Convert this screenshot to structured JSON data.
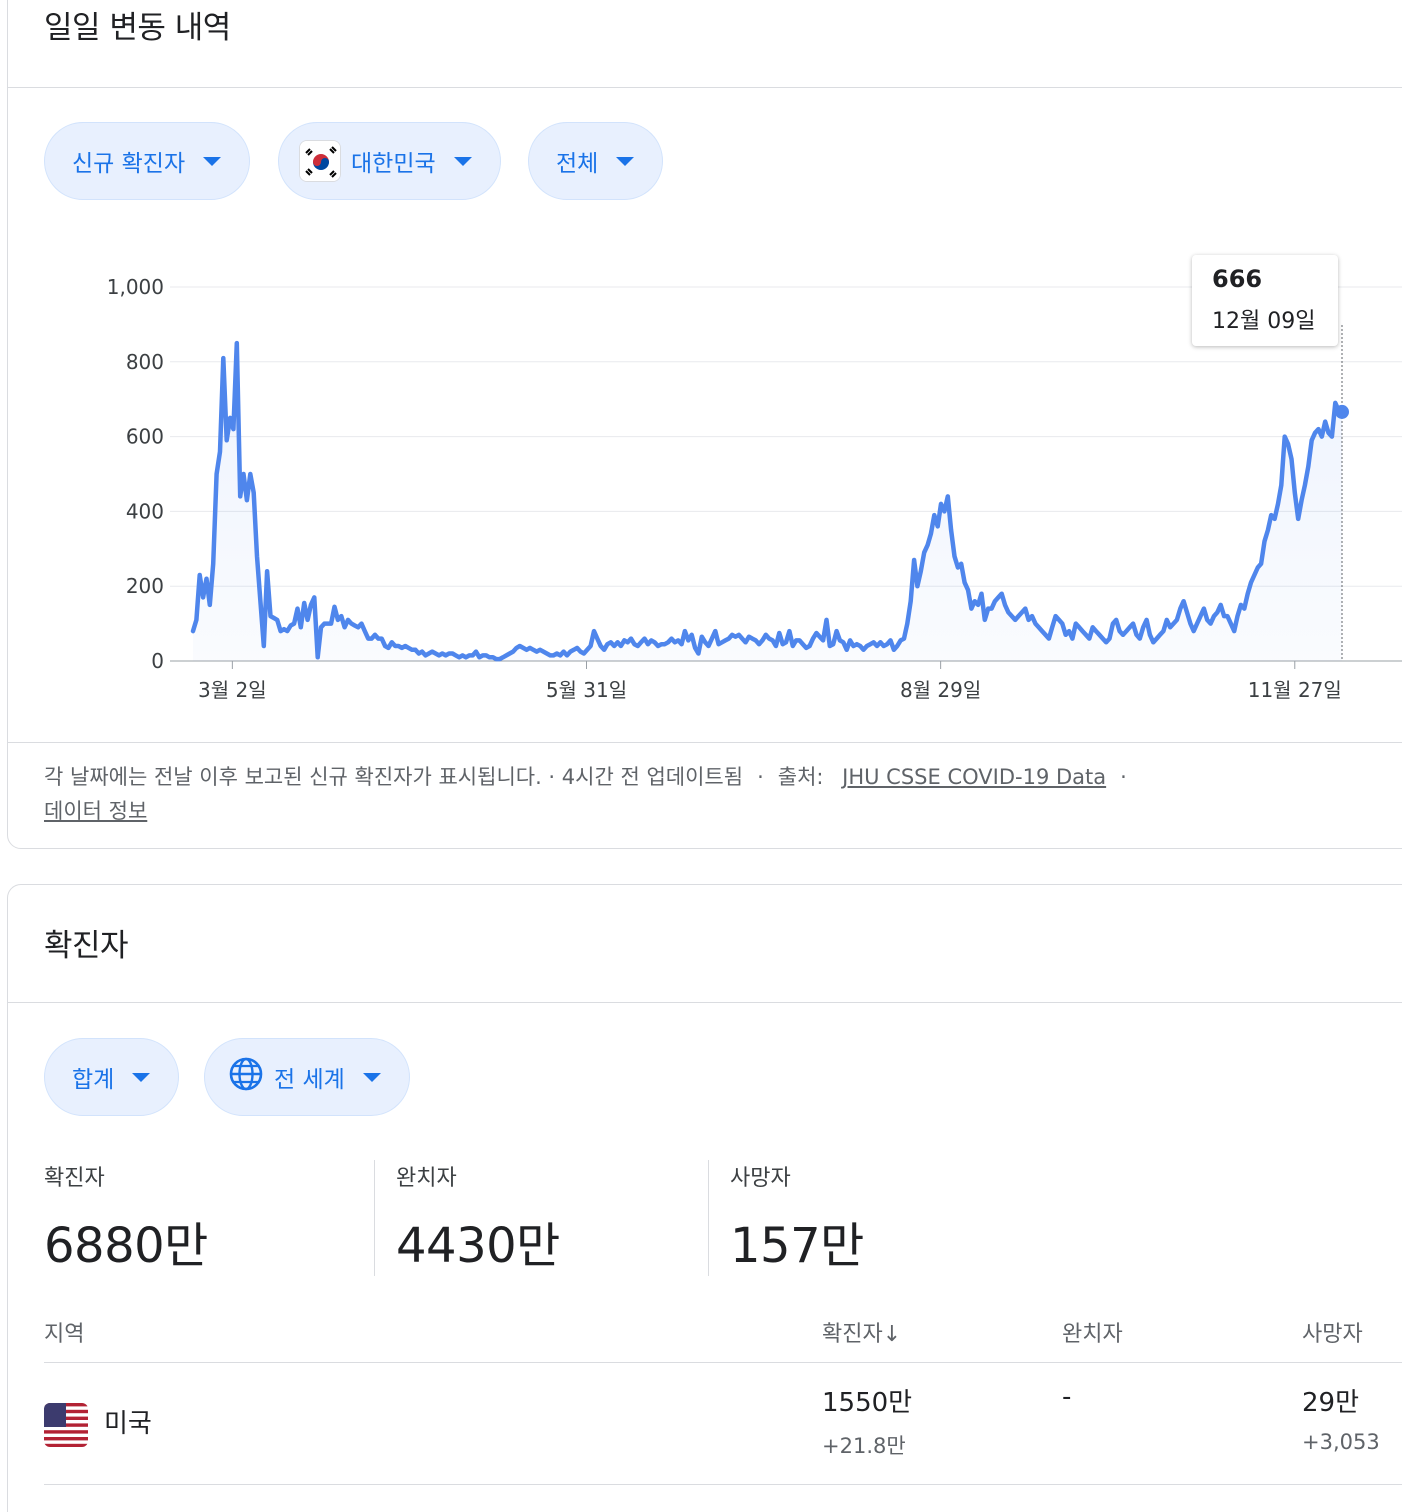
{
  "daily": {
    "title": "일일 변동 내역",
    "chips": {
      "metric": "신규 확진자",
      "country": "대한민국",
      "range": "전체"
    },
    "tooltip": {
      "value": "666",
      "date": "12월 09일"
    },
    "footnote": {
      "text": "각 날짜에는 전날 이후 보고된 신규 확진자가 표시됩니다. · 4시간 전 업데이트됨",
      "source_label": "출처:",
      "source_link": "JHU CSSE COVID-19 Data",
      "about_link": "데이터 정보"
    }
  },
  "chart_data": {
    "type": "area",
    "xlabel": "",
    "ylabel": "",
    "ylim": [
      0,
      1000
    ],
    "yticks": [
      0,
      200,
      400,
      600,
      800,
      1000
    ],
    "ytick_labels": [
      "0",
      "200",
      "400",
      "600",
      "800",
      "1,000"
    ],
    "xticks": [
      {
        "day": 10,
        "label": "3월 2일"
      },
      {
        "day": 100,
        "label": "5월 31일"
      },
      {
        "day": 190,
        "label": "8월 29일"
      },
      {
        "day": 280,
        "label": "11월 27일"
      }
    ],
    "x_range": [
      0,
      292
    ],
    "grid": true,
    "color": "#4f86ec",
    "highlight": {
      "day": 292,
      "value": 666
    },
    "series": [
      {
        "values": [
          80,
          110,
          230,
          170,
          220,
          150,
          260,
          500,
          560,
          810,
          590,
          650,
          620,
          850,
          440,
          500,
          430,
          500,
          450,
          280,
          160,
          40,
          240,
          120,
          115,
          110,
          80,
          85,
          80,
          95,
          100,
          140,
          90,
          155,
          110,
          150,
          170,
          10,
          90,
          100,
          100,
          100,
          145,
          110,
          120,
          90,
          110,
          100,
          95,
          90,
          100,
          80,
          60,
          60,
          70,
          60,
          60,
          40,
          35,
          50,
          40,
          40,
          35,
          40,
          35,
          30,
          30,
          20,
          25,
          15,
          20,
          25,
          20,
          15,
          20,
          15,
          20,
          20,
          15,
          10,
          15,
          10,
          15,
          15,
          25,
          10,
          15,
          15,
          10,
          10,
          5,
          5,
          10,
          15,
          20,
          25,
          35,
          40,
          35,
          30,
          35,
          30,
          25,
          30,
          25,
          20,
          15,
          15,
          20,
          15,
          25,
          15,
          25,
          30,
          35,
          25,
          20,
          30,
          40,
          80,
          60,
          40,
          30,
          45,
          50,
          40,
          50,
          40,
          55,
          50,
          60,
          45,
          40,
          50,
          60,
          45,
          55,
          50,
          40,
          45,
          45,
          50,
          60,
          50,
          55,
          45,
          80,
          55,
          70,
          35,
          20,
          65,
          50,
          40,
          60,
          80,
          45,
          50,
          55,
          60,
          70,
          65,
          70,
          60,
          50,
          65,
          60,
          55,
          45,
          55,
          70,
          60,
          55,
          40,
          75,
          45,
          50,
          80,
          40,
          55,
          55,
          45,
          35,
          40,
          60,
          75,
          65,
          55,
          110,
          40,
          45,
          80,
          55,
          50,
          30,
          55,
          40,
          45,
          40,
          30,
          40,
          45,
          50,
          40,
          50,
          40,
          45,
          55,
          30,
          40,
          55,
          60,
          100,
          160,
          270,
          200,
          240,
          290,
          310,
          340,
          390,
          360,
          420,
          400,
          440,
          350,
          280,
          250,
          260,
          210,
          190,
          140,
          160,
          150,
          180,
          110,
          140,
          140,
          160,
          170,
          180,
          150,
          130,
          120,
          110,
          120,
          130,
          140,
          110,
          120,
          100,
          90,
          80,
          70,
          60,
          90,
          120,
          110,
          100,
          70,
          80,
          60,
          100,
          90,
          80,
          70,
          60,
          90,
          80,
          70,
          60,
          50,
          60,
          100,
          110,
          80,
          70,
          80,
          90,
          100,
          70,
          60,
          90,
          110,
          70,
          50,
          60,
          70,
          80,
          110,
          90,
          100,
          110,
          140,
          160,
          130,
          100,
          80,
          100,
          120,
          140,
          110,
          100,
          120,
          130,
          150,
          120,
          120,
          100,
          80,
          120,
          150,
          140,
          180,
          210,
          230,
          250,
          260,
          320,
          350,
          390,
          380,
          420,
          470,
          600,
          580,
          540,
          450,
          380,
          430,
          470,
          520,
          590,
          610,
          620,
          600,
          640,
          610,
          600,
          690,
          670,
          666
        ]
      }
    ]
  },
  "cases": {
    "title": "확진자",
    "chips": {
      "type": "합계",
      "region": "전 세계"
    },
    "stats": [
      {
        "label": "확진자",
        "value": "6880만"
      },
      {
        "label": "완치자",
        "value": "4430만"
      },
      {
        "label": "사망자",
        "value": "157만"
      }
    ],
    "table": {
      "headers": {
        "region": "지역",
        "confirmed": "확진자",
        "recovered": "완치자",
        "deaths": "사망자"
      },
      "sort_arrow": "↓",
      "rows": [
        {
          "region": "미국",
          "confirmed": "1550만",
          "confirmed_new": "+21.8만",
          "recovered": "-",
          "deaths": "29만",
          "deaths_new": "+3,053"
        }
      ]
    }
  }
}
